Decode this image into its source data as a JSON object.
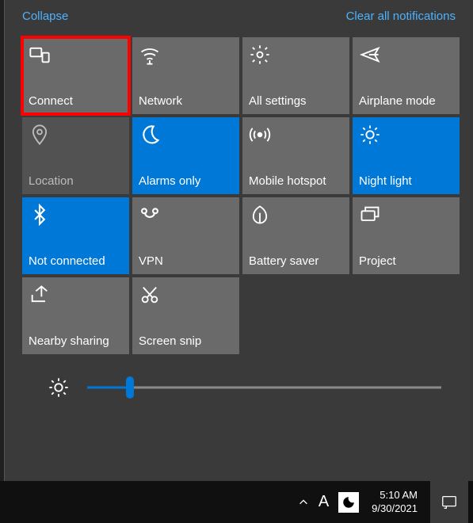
{
  "header": {
    "collapse": "Collapse",
    "clear": "Clear all notifications"
  },
  "tiles": [
    {
      "id": "connect",
      "label": "Connect",
      "icon": "connect",
      "state": "default",
      "highlight": true
    },
    {
      "id": "network",
      "label": "Network",
      "icon": "wifi",
      "state": "default",
      "highlight": false
    },
    {
      "id": "all-settings",
      "label": "All settings",
      "icon": "gear",
      "state": "default",
      "highlight": false
    },
    {
      "id": "airplane-mode",
      "label": "Airplane mode",
      "icon": "airplane",
      "state": "default",
      "highlight": false
    },
    {
      "id": "location",
      "label": "Location",
      "icon": "location",
      "state": "dim",
      "highlight": false
    },
    {
      "id": "alarms-only",
      "label": "Alarms only",
      "icon": "moon",
      "state": "on",
      "highlight": false
    },
    {
      "id": "mobile-hotspot",
      "label": "Mobile hotspot",
      "icon": "hotspot",
      "state": "default",
      "highlight": false
    },
    {
      "id": "night-light",
      "label": "Night light",
      "icon": "sun",
      "state": "on",
      "highlight": false
    },
    {
      "id": "bluetooth",
      "label": "Not connected",
      "icon": "bluetooth",
      "state": "on",
      "highlight": false
    },
    {
      "id": "vpn",
      "label": "VPN",
      "icon": "vpn",
      "state": "default",
      "highlight": false
    },
    {
      "id": "battery-saver",
      "label": "Battery saver",
      "icon": "leaf",
      "state": "default",
      "highlight": false
    },
    {
      "id": "project",
      "label": "Project",
      "icon": "project",
      "state": "default",
      "highlight": false
    },
    {
      "id": "nearby-sharing",
      "label": "Nearby sharing",
      "icon": "share",
      "state": "default",
      "highlight": false
    },
    {
      "id": "screen-snip",
      "label": "Screen snip",
      "icon": "snip",
      "state": "default",
      "highlight": false
    }
  ],
  "brightness": {
    "percent": 12
  },
  "taskbar": {
    "ime": "A",
    "time": "5:10 AM",
    "date": "9/30/2021"
  },
  "colors": {
    "accent": "#0078d7",
    "link": "#4db2ff",
    "highlight": "#ff0000"
  }
}
